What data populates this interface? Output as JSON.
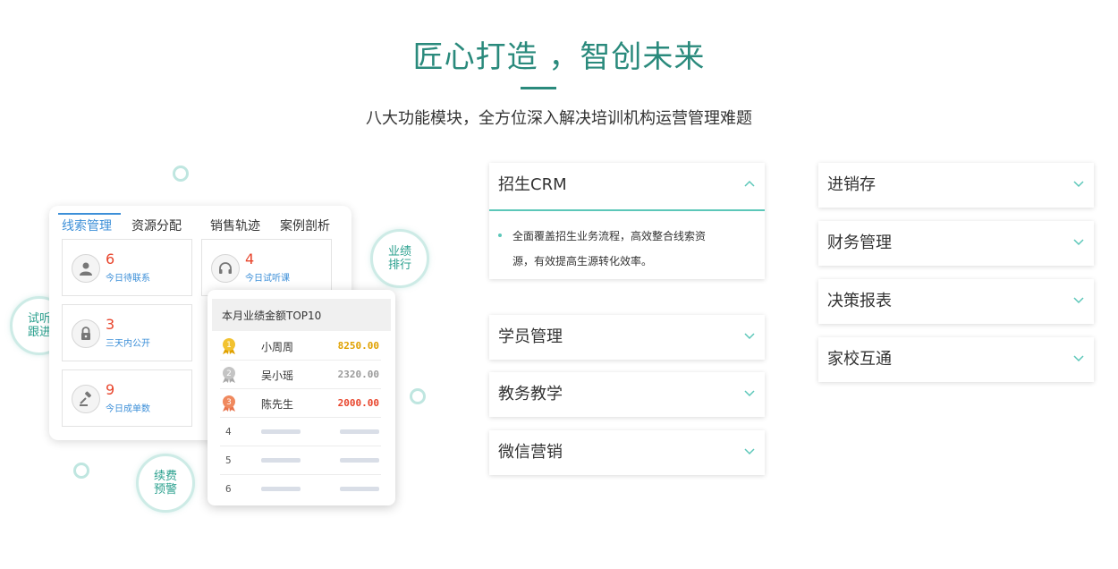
{
  "hero": {
    "title": "匠心打造 ，智创未来",
    "subtitle": "八大功能模块，全方位深入解决培训机构运营管理难题"
  },
  "bubbles": {
    "left": [
      "试听",
      "跟进"
    ],
    "right": [
      "业绩",
      "排行"
    ],
    "bottom": [
      "续费",
      "预警"
    ]
  },
  "main_card": {
    "tabs": [
      "线索管理",
      "资源分配",
      "销售轨迹",
      "案例剖析"
    ],
    "active_tab": "线索管理",
    "stats": [
      {
        "number": "6",
        "label": "今日待联系",
        "icon": "user-icon"
      },
      {
        "number": "4",
        "label": "今日试听课",
        "icon": "headphones-icon"
      },
      {
        "number": "3",
        "label": "三天内公开",
        "icon": "lock-icon"
      },
      {
        "number": "9",
        "label": "今日成单数",
        "icon": "gavel-icon"
      }
    ]
  },
  "top_card": {
    "title": "本月业绩金额TOP10",
    "rows": [
      {
        "rank": "1",
        "name": "小周周",
        "value": "8250.00",
        "medal": "gold",
        "color": "#e0a100"
      },
      {
        "rank": "2",
        "name": "吴小瑶",
        "value": "2320.00",
        "medal": "silver",
        "color": "#9a9a9a"
      },
      {
        "rank": "3",
        "name": "陈先生",
        "value": "2000.00",
        "medal": "bronze",
        "color": "#e8452c"
      },
      {
        "rank": "4"
      },
      {
        "rank": "5"
      },
      {
        "rank": "6"
      }
    ]
  },
  "modules": {
    "left": [
      {
        "title": "招生CRM",
        "expanded": true,
        "desc_line1": "全面覆盖招生业务流程，高效整合线索资",
        "desc_line2": "源，有效提高生源转化效率。"
      },
      {
        "title": "学员管理"
      },
      {
        "title": "教务教学"
      },
      {
        "title": "微信营销"
      }
    ],
    "right": [
      {
        "title": "进销存"
      },
      {
        "title": "财务管理"
      },
      {
        "title": "决策报表"
      },
      {
        "title": "家校互通"
      }
    ]
  },
  "colors": {
    "brand": "#2a8a7c",
    "accent": "#5cc7b9",
    "link": "#3c8fd8",
    "number": "#e8452c"
  }
}
